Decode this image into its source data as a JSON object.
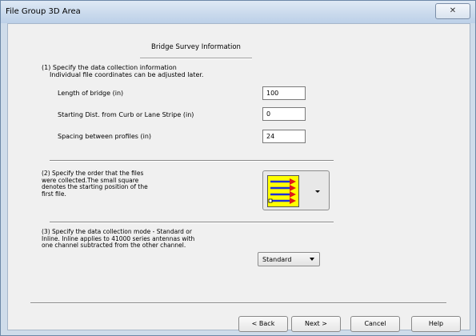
{
  "window": {
    "title": "File Group 3D Area",
    "close_glyph": "✕"
  },
  "header": {
    "title": "Bridge Survey Information"
  },
  "section1": {
    "line1": "(1) Specify the data collection information",
    "line2": "Individual file coordinates can be adjusted later.",
    "fields": [
      {
        "label": "Length of bridge  (in)",
        "value": "100"
      },
      {
        "label": "Starting Dist. from Curb or Lane Stripe  (in)",
        "value": "0"
      },
      {
        "label": "Spacing between profiles     (in)",
        "value": "24"
      }
    ]
  },
  "section2": {
    "lines": [
      "(2) Specify the order that the files",
      "were collected.The small square",
      "denotes the starting position of the",
      "first file."
    ],
    "icon": "collection-order-icon"
  },
  "section3": {
    "lines": [
      "(3) Specify the data collection mode - Standard or",
      "Inline. Inline applies to 41000 series antennas with",
      "one channel subtracted from the other channel."
    ],
    "mode_selected": "Standard"
  },
  "buttons": {
    "back": "< Back",
    "next": "Next >",
    "cancel": "Cancel",
    "help": "Help"
  },
  "colors": {
    "order_icon_bg": "#ffff00",
    "arrow_blue": "#1f2fd6",
    "arrow_red": "#e01818"
  }
}
